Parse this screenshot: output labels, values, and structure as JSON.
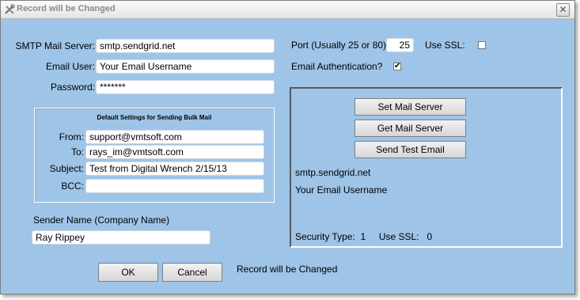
{
  "window": {
    "title": "Record will be Changed"
  },
  "smtp": {
    "server_label": "SMTP Mail Server:",
    "server_value": "smtp.sendgrid.net",
    "user_label": "Email User:",
    "user_value": "Your Email Username",
    "password_label": "Password:",
    "password_value": "*******"
  },
  "port": {
    "label": "Port (Usually 25 or 80)",
    "value": "25",
    "ssl_label": "Use SSL:",
    "ssl_checked": false,
    "auth_label": "Email Authentication?",
    "auth_checked": true,
    "check_mark": "✔"
  },
  "defaults": {
    "title": "Default Settings for Sending Bulk Mail",
    "from_label": "From:",
    "from_value": "support@vmtsoft.com",
    "to_label": "To:",
    "to_value": "rays_im@vmtsoft.com",
    "subject_label": "Subject:",
    "subject_value": "Test from Digital Wrench 2/15/13",
    "bcc_label": "BCC:",
    "bcc_value": ""
  },
  "sender": {
    "label": "Sender Name (Company Name)",
    "value": "Ray Rippey"
  },
  "panel": {
    "set_button": "Set Mail Server",
    "get_button": "Get Mail Server",
    "test_button": "Send Test Email",
    "server_text": "smtp.sendgrid.net",
    "user_text": "Your Email Username",
    "security_text": "Security Type:  1     Use SSL:   0"
  },
  "footer": {
    "ok": "OK",
    "cancel": "Cancel",
    "status": "Record will be Changed"
  }
}
